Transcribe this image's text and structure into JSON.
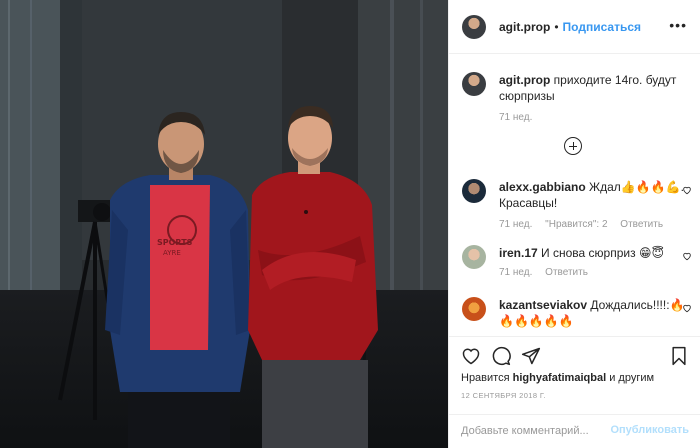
{
  "header": {
    "username": "agit.prop",
    "separator": "•",
    "follow_label": "Подписаться",
    "more_icon": "more-dots-icon"
  },
  "caption": {
    "username": "agit.prop",
    "text": "приходите 14го. будут сюрпризы",
    "time": "71 нед."
  },
  "comments": [
    {
      "username": "alexx.gabbiano",
      "text": "Ждал👍🔥🔥💪. Красавцы!",
      "time": "71 нед.",
      "likes": "\"Нравится\": 2",
      "reply": "Ответить"
    },
    {
      "username": "iren.17",
      "text": "И снова сюрприз 😁😇",
      "time": "71 нед.",
      "reply": "Ответить"
    },
    {
      "username": "kazantseviakov",
      "text": "Дождались!!!!:🔥🔥🔥🔥🔥🔥"
    }
  ],
  "load_more_icon": "plus-circle-icon",
  "actions": {
    "like_icon": "heart-icon",
    "comment_icon": "comment-icon",
    "share_icon": "share-icon",
    "save_icon": "bookmark-icon"
  },
  "likes": {
    "prefix": "Нравится",
    "user": "highyafatimaiqbal",
    "suffix": "и другим"
  },
  "date": "12 СЕНТЯБРЯ 2018 Г.",
  "add_comment": {
    "placeholder": "Добавьте комментарий...",
    "publish_label": "Опубликовать"
  },
  "colors": {
    "accent": "#3897f0",
    "publish_disabled": "#b2dffc",
    "muted": "#999999",
    "border": "#efefef"
  }
}
